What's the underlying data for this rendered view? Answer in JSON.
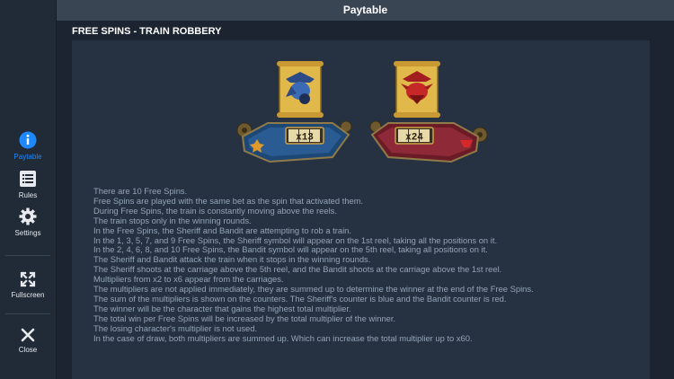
{
  "header": {
    "title": "Paytable"
  },
  "sidebar": {
    "items": [
      {
        "label": "Paytable",
        "icon": "info-icon",
        "active": true
      },
      {
        "label": "Rules",
        "icon": "list-icon"
      },
      {
        "label": "Settings",
        "icon": "gear-icon"
      },
      {
        "label": "Fullscreen",
        "icon": "fullscreen-icon"
      },
      {
        "label": "Close",
        "icon": "close-icon"
      }
    ]
  },
  "section": {
    "title": "FREE SPINS - TRAIN ROBBERY"
  },
  "counters": {
    "sheriff": {
      "value": "x13",
      "color": "#1e4a7a"
    },
    "bandit": {
      "value": "x24",
      "color": "#7a1e2a"
    }
  },
  "paragraphs": [
    "There are 10 Free Spins.",
    "Free Spins are played with the same bet as the spin that activated them.",
    "During Free Spins, the train is constantly moving above the reels.",
    "The train stops only in the winning rounds.",
    "In the Free Spins, the Sheriff and Bandit are attempting to rob a train.",
    "In the 1, 3, 5, 7, and 9 Free Spins, the Sheriff symbol will appear on the 1st reel, taking all the positions on it.",
    "In the 2, 4, 6, 8, and 10 Free Spins, the Bandit symbol will appear on the 5th reel, taking all positions on it.",
    "The Sheriff and Bandit attack the train when it stops in the winning rounds.",
    "The Sheriff shoots at the carriage above the 5th reel, and the Bandit shoots at the carriage above the 1st reel.",
    "Multipliers from x2 to x6 appear from the carriages.",
    "The multipliers are not applied immediately, they are summed up to determine the winner at the end of the Free Spins.",
    "The sum of the multipliers is shown on the counters. The Sheriff's counter is blue and the Bandit counter is red.",
    "The winner will be the character that gains the highest total multiplier.",
    "The total win per Free Spins will be increased by the total multiplier of the winner.",
    "The losing character's multiplier is not used.",
    "In the case of draw, both multipliers are summed up. Which can increase the total multiplier up to x60."
  ]
}
